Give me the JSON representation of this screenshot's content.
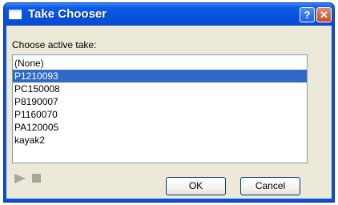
{
  "window": {
    "title": "Take Chooser",
    "help_label": "?",
    "close_label": "✕",
    "icon": "window-icon"
  },
  "dialog": {
    "prompt": "Choose active take:",
    "takes": [
      "(None)",
      "P1210093",
      "PC150008",
      "P8190007",
      "P1160070",
      "PA120005",
      "kayak2"
    ],
    "selected_take": "P1210093"
  },
  "controls": {
    "play_icon": "play-icon",
    "stop_icon": "stop-icon",
    "ok_label": "OK",
    "cancel_label": "Cancel"
  },
  "colors": {
    "titlebar": "#0653dd",
    "selection": "#316ac5",
    "dialog_background": "#ece9d8",
    "close_button": "#d0461f"
  }
}
